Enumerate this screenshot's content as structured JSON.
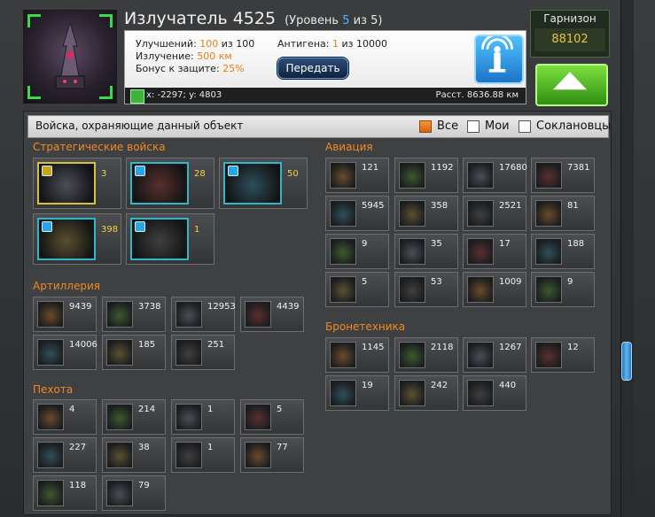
{
  "header": {
    "title": "Излучатель 4525",
    "level_prefix": "(Уровень ",
    "level_value": "5",
    "level_suffix": " из 5)",
    "upgrades_label": "Улучшений: ",
    "upgrades_value": "100",
    "upgrades_of": " из 100",
    "radiation_label": "Излучение: ",
    "radiation_value": "500 км",
    "defense_label": "Бонус к защите: ",
    "defense_value": "25%",
    "antigen_label": "Антигена: ",
    "antigen_value": "1",
    "antigen_of": " из 10000",
    "transfer_button": "Передать",
    "coords": "x: -2297; y: 4803",
    "distance": "Расст. 8636.88 км",
    "garrison_label": "Гарнизон",
    "garrison_value": "88102"
  },
  "guard": {
    "title": "Войска, охраняющие данный объект",
    "filter_all": "Все",
    "filter_mine": "Мои",
    "filter_clan": "Соклановцы"
  },
  "sections": {
    "strategic": "Стратегические войска",
    "artillery": "Артиллерия",
    "infantry": "Пехота",
    "aviation": "Авиация",
    "armor": "Бронетехника"
  },
  "strategic": [
    "3",
    "28",
    "50",
    "398",
    "1"
  ],
  "artillery": [
    "9439",
    "3738",
    "12953",
    "4439",
    "14006",
    "185",
    "251"
  ],
  "infantry": [
    "4",
    "214",
    "1",
    "5",
    "227",
    "38",
    "1",
    "77",
    "118",
    "79"
  ],
  "aviation": [
    "121",
    "1192",
    "17680",
    "7381",
    "5945",
    "358",
    "2521",
    "81",
    "9",
    "35",
    "17",
    "188",
    "5",
    "53",
    "1009",
    "9"
  ],
  "armor": [
    "1145",
    "2118",
    "1267",
    "12",
    "19",
    "242",
    "440"
  ],
  "colors": {
    "accent_orange": "#f08a22",
    "count_gold": "#f2d23f",
    "level_blue": "#4fb6ff",
    "green_button": "#47b51f"
  }
}
